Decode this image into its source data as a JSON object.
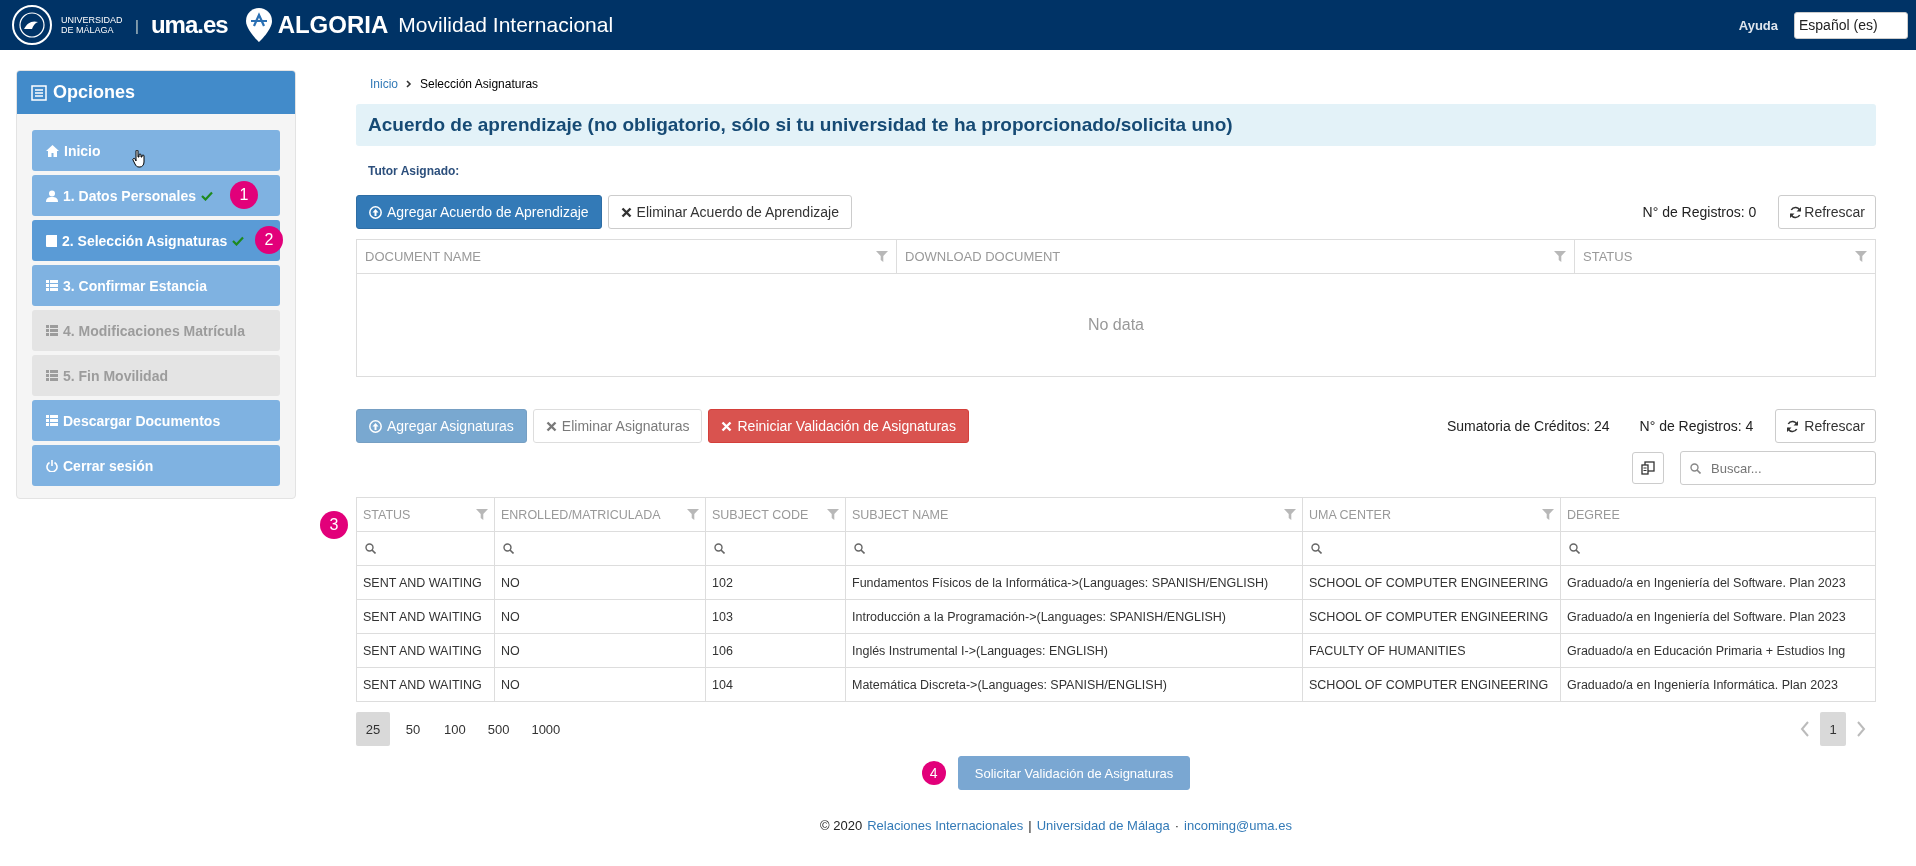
{
  "header": {
    "university": "UNIVERSIDAD DE MÁLAGA",
    "separator": "|",
    "site": "uma.es",
    "brand": "ALGORIA",
    "app_title": "Movilidad Internacional",
    "help": "Ayuda",
    "language": {
      "value": "Español (es)"
    }
  },
  "sidebar": {
    "title": "Opciones",
    "items": [
      {
        "label": "Inicio",
        "kind": "home",
        "selected": false,
        "disabled": false,
        "done": false
      },
      {
        "label": "1. Datos Personales",
        "kind": "user",
        "selected": false,
        "disabled": false,
        "done": true,
        "badge": "1"
      },
      {
        "label": "2. Selección Asignaturas",
        "kind": "book",
        "selected": true,
        "disabled": false,
        "done": true,
        "badge": "2"
      },
      {
        "label": "3. Confirmar Estancia",
        "kind": "list",
        "selected": false,
        "disabled": false,
        "done": false
      },
      {
        "label": "4. Modificaciones Matrícula",
        "kind": "list",
        "selected": false,
        "disabled": true,
        "done": false
      },
      {
        "label": "5. Fin Movilidad",
        "kind": "list",
        "selected": false,
        "disabled": true,
        "done": false
      },
      {
        "label": "Descargar Documentos",
        "kind": "list",
        "selected": false,
        "disabled": false,
        "done": false
      },
      {
        "label": "Cerrar sesión",
        "kind": "power",
        "selected": false,
        "disabled": false,
        "done": false
      }
    ]
  },
  "breadcrumb": [
    {
      "label": "Inicio",
      "kind": "link"
    },
    {
      "label": "Selección Asignaturas",
      "kind": "current"
    }
  ],
  "agreement": {
    "title": "Acuerdo de aprendizaje (no obligatorio, sólo si tu universidad te ha proporcionado/solicita uno)",
    "tutor_label": "Tutor Asignado:",
    "buttons": [
      {
        "label": "Agregar Acuerdo de Aprendizaje",
        "kind": "primary",
        "disabled": false
      },
      {
        "label": "Eliminar Acuerdo de Aprendizaje",
        "kind": "default",
        "disabled": false
      }
    ],
    "record_count": "N° de Registros: 0",
    "refresh": "Refrescar",
    "table": {
      "columns": [
        "DOCUMENT NAME",
        "DOWNLOAD DOCUMENT",
        "STATUS"
      ],
      "empty": "No data"
    }
  },
  "subjects": {
    "marker": "3",
    "buttons": [
      {
        "label": "Agregar Asignaturas",
        "kind": "primary",
        "disabled": true
      },
      {
        "label": "Eliminar Asignaturas",
        "kind": "default",
        "disabled": true
      },
      {
        "label": "Reiniciar Validación de Asignaturas",
        "kind": "danger",
        "disabled": false
      }
    ],
    "credits": "Sumatoria de Créditos: 24",
    "record_count": "N° de Registros: 4",
    "refresh": "Refrescar",
    "search": {
      "placeholder": "Buscar..."
    },
    "table": {
      "columns": [
        "STATUS",
        "ENROLLED/MATRICULADA",
        "SUBJECT CODE",
        "SUBJECT NAME",
        "UMA CENTER",
        "DEGREE"
      ],
      "rows": [
        [
          "SENT AND WAITING",
          "NO",
          "102",
          "Fundamentos Físicos de la Informática->(Languages: SPANISH/ENGLISH)",
          "SCHOOL OF COMPUTER ENGINEERING",
          "Graduado/a en Ingeniería del Software. Plan 2023"
        ],
        [
          "SENT AND WAITING",
          "NO",
          "103",
          "Introducción a la Programación->(Languages: SPANISH/ENGLISH)",
          "SCHOOL OF COMPUTER ENGINEERING",
          "Graduado/a en Ingeniería del Software. Plan 2023"
        ],
        [
          "SENT AND WAITING",
          "NO",
          "106",
          "Inglés Instrumental I->(Languages: ENGLISH)",
          "FACULTY OF HUMANITIES",
          "Graduado/a en Educación Primaria + Estudios Ing"
        ],
        [
          "SENT AND WAITING",
          "NO",
          "104",
          "Matemática Discreta->(Languages: SPANISH/ENGLISH)",
          "SCHOOL OF COMPUTER ENGINEERING",
          "Graduado/a en Ingeniería Informática. Plan 2023"
        ]
      ]
    },
    "page_sizes": [
      {
        "label": "25",
        "selected": true
      },
      {
        "label": "50",
        "selected": false
      },
      {
        "label": "100",
        "selected": false
      },
      {
        "label": "500",
        "selected": false
      },
      {
        "label": "1000",
        "selected": false
      }
    ],
    "pages": [
      {
        "label": "1",
        "selected": true
      }
    ]
  },
  "submit": {
    "label": "Solicitar Validación de Asignaturas",
    "disabled": true,
    "marker": "4"
  },
  "footer": [
    {
      "text": "© 2020",
      "kind": "text"
    },
    {
      "text": "Relaciones Internacionales",
      "kind": "link"
    },
    {
      "text": "|",
      "kind": "text"
    },
    {
      "text": "Universidad de Málaga",
      "kind": "link"
    },
    {
      "text": "·",
      "kind": "text"
    },
    {
      "text": "incoming@uma.es",
      "kind": "link"
    }
  ]
}
